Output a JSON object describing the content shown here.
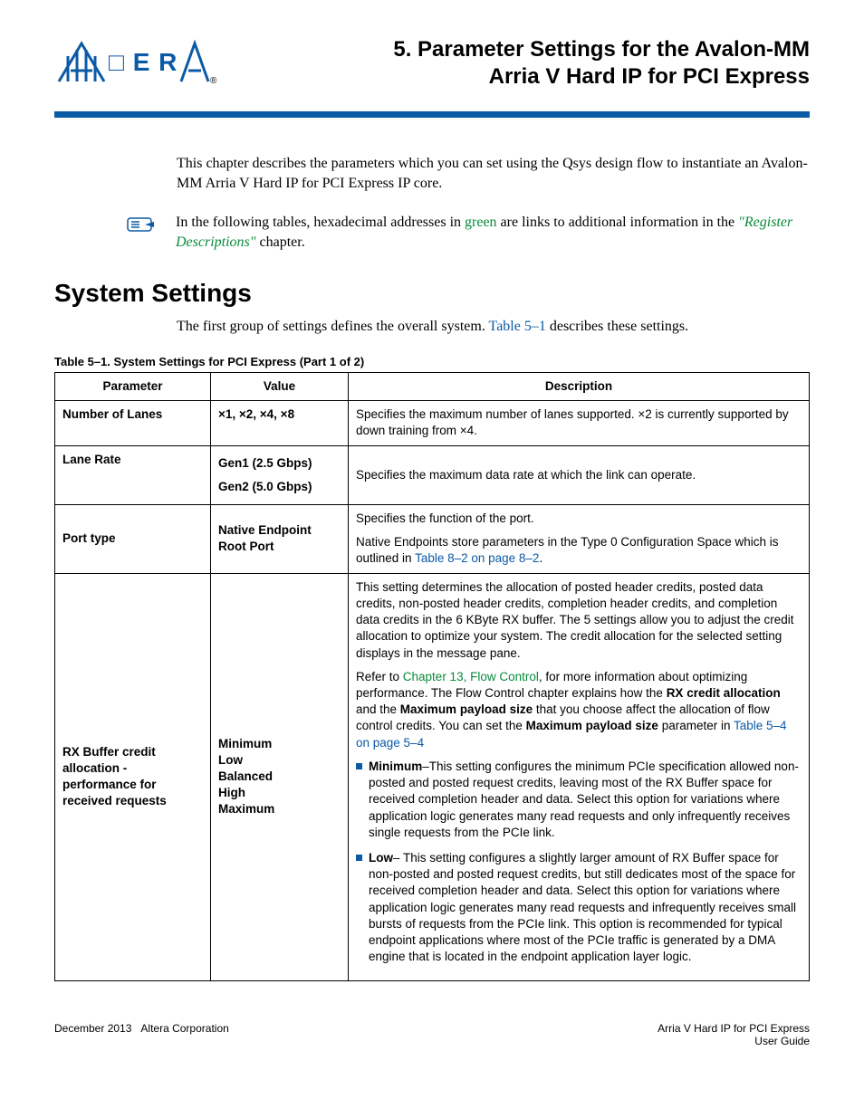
{
  "header": {
    "chapter_num": "5.",
    "chapter_title_line1": "Parameter Settings for the Avalon-MM",
    "chapter_title_line2": "Arria  V Hard IP for PCI Express"
  },
  "intro": {
    "p1": "This chapter describes the parameters which you can set using the Qsys design flow to instantiate an Avalon-MM Arria  V Hard IP for PCI Express IP core.",
    "note_prefix": "In the following tables, hexadecimal addresses in ",
    "note_green": "green",
    "note_mid": " are links to additional information in the ",
    "note_link": "\"Register Descriptions\"",
    "note_suffix": " chapter."
  },
  "section": {
    "heading": "System Settings",
    "p1_prefix": "The first group of settings defines the overall system. ",
    "p1_link": "Table 5–1",
    "p1_suffix": " describes these settings."
  },
  "table": {
    "caption": "Table 5–1.  System Settings for PCI Express  (Part 1 of 2)",
    "headers": {
      "param": "Parameter",
      "value": "Value",
      "desc": "Description"
    },
    "rows": {
      "lanes": {
        "param": "Number of Lanes",
        "value": "×1, ×2, ×4, ×8",
        "desc": "Specifies the maximum number of lanes supported. ×2 is currently supported by down training from ×4."
      },
      "lanerate": {
        "param": "Lane Rate",
        "value1": "Gen1 (2.5 Gbps)",
        "value2": "Gen2 (5.0 Gbps)",
        "desc": "Specifies the maximum data rate at which the link can operate."
      },
      "porttype": {
        "param": "Port type",
        "value1": "Native Endpoint",
        "value2": "Root Port",
        "desc_p1": "Specifies the function of the port.",
        "desc_p2_prefix": "Native Endpoints store parameters in the Type 0 Configuration Space which is outlined in ",
        "desc_p2_link": "Table 8–2 on page 8–2",
        "desc_p2_suffix": "."
      },
      "rxbuf": {
        "param": "RX Buffer credit allocation - performance for received requests",
        "value1": "Minimum",
        "value2": "Low",
        "value3": "Balanced",
        "value4": "High",
        "value5": "Maximum",
        "desc_p1": "This setting determines the allocation of posted header credits, posted data credits, non-posted header credits, completion header credits, and completion data credits in the 6 KByte RX buffer. The 5 settings allow you to adjust the credit allocation to optimize your system. The credit allocation for the selected setting displays in the message pane.",
        "desc_p2_prefix": "Refer to ",
        "desc_p2_link1": "Chapter 13, Flow Control",
        "desc_p2_mid1": ", for more information about optimizing performance. The Flow Control chapter explains how the ",
        "desc_p2_bold1": "RX credit allocation",
        "desc_p2_mid2": " and the ",
        "desc_p2_bold2": "Maximum payload size",
        "desc_p2_mid3": " that you choose affect the allocation of flow control credits. You can set the ",
        "desc_p2_bold3": "Maximum payload size",
        "desc_p2_mid4": " parameter in ",
        "desc_p2_link2": "Table 5–4 on page 5–4",
        "bullet1_label": "Minimum",
        "bullet1_text": "–This setting configures the minimum PCIe specification allowed non-posted and posted request credits, leaving most of the RX Buffer space for received completion header and data. Select this option for variations where application logic generates many read requests and only infrequently receives single requests from the PCIe link.",
        "bullet2_label": "Low",
        "bullet2_text": "– This setting configures a slightly larger amount of RX Buffer space for non-posted and posted request credits, but still dedicates most of the space for received completion header and data. Select this option for variations where application logic generates many read requests and infrequently receives small bursts of requests from the PCIe link. This option is recommended for typical endpoint applications where most of the PCIe traffic is generated by a DMA engine that is located in the endpoint application layer logic."
      }
    }
  },
  "footer": {
    "left_date": "December 2013",
    "left_company": "Altera Corporation",
    "right_doc": "Arria V Hard IP for PCI Express",
    "right_sub": "User Guide"
  }
}
